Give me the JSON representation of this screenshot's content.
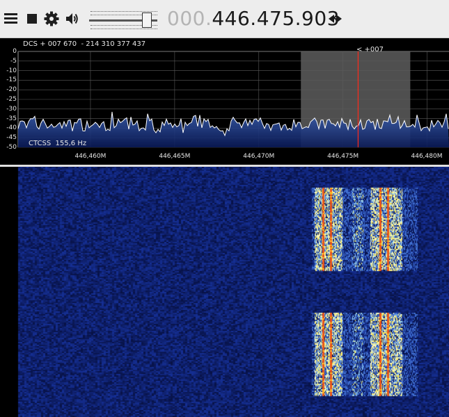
{
  "toolbar": {
    "frequency_leading": "000.",
    "frequency_main": "446.475.903",
    "volume_level": 0.84
  },
  "icons": {
    "menu": "hamburger-menu-icon",
    "stop": "stop-icon",
    "settings": "gear-icon",
    "audio": "speaker-icon",
    "tune": "left-right-arrows-icon"
  },
  "spectrum": {
    "dcs_text": "DCS + 007 670  - 214 310 377 437",
    "ctcss_text": "CTCSS  155,6 Hz",
    "offset_text": "< +007",
    "y_ticks": [
      "0",
      "-5",
      "-10",
      "-15",
      "-20",
      "-25",
      "-30",
      "-35",
      "-40",
      "-45",
      "-50"
    ],
    "x_ticks": [
      "446,460M",
      "446,465M",
      "446,470M",
      "446,475M",
      "446,480M"
    ]
  },
  "colors": {
    "toolbar_bg": "#ededed",
    "plot_bg": "#000000",
    "grid": "#5a5a5a",
    "trace": "#ffffff",
    "fill_top": "#3a5fb0",
    "fill_bottom": "#0a1a58",
    "passband": "#6a6a6a",
    "tuned_line": "#ff2a1a",
    "waterfall_bg": "#0a1440"
  },
  "chart_data": {
    "type": "line",
    "ylim": [
      -50,
      0
    ],
    "xlim": [
      446.4557,
      446.4813
    ],
    "noise_floor_db": -38,
    "passband": [
      446.4725,
      446.479
    ],
    "tuned_frequency": 446.4759,
    "grid": true
  }
}
